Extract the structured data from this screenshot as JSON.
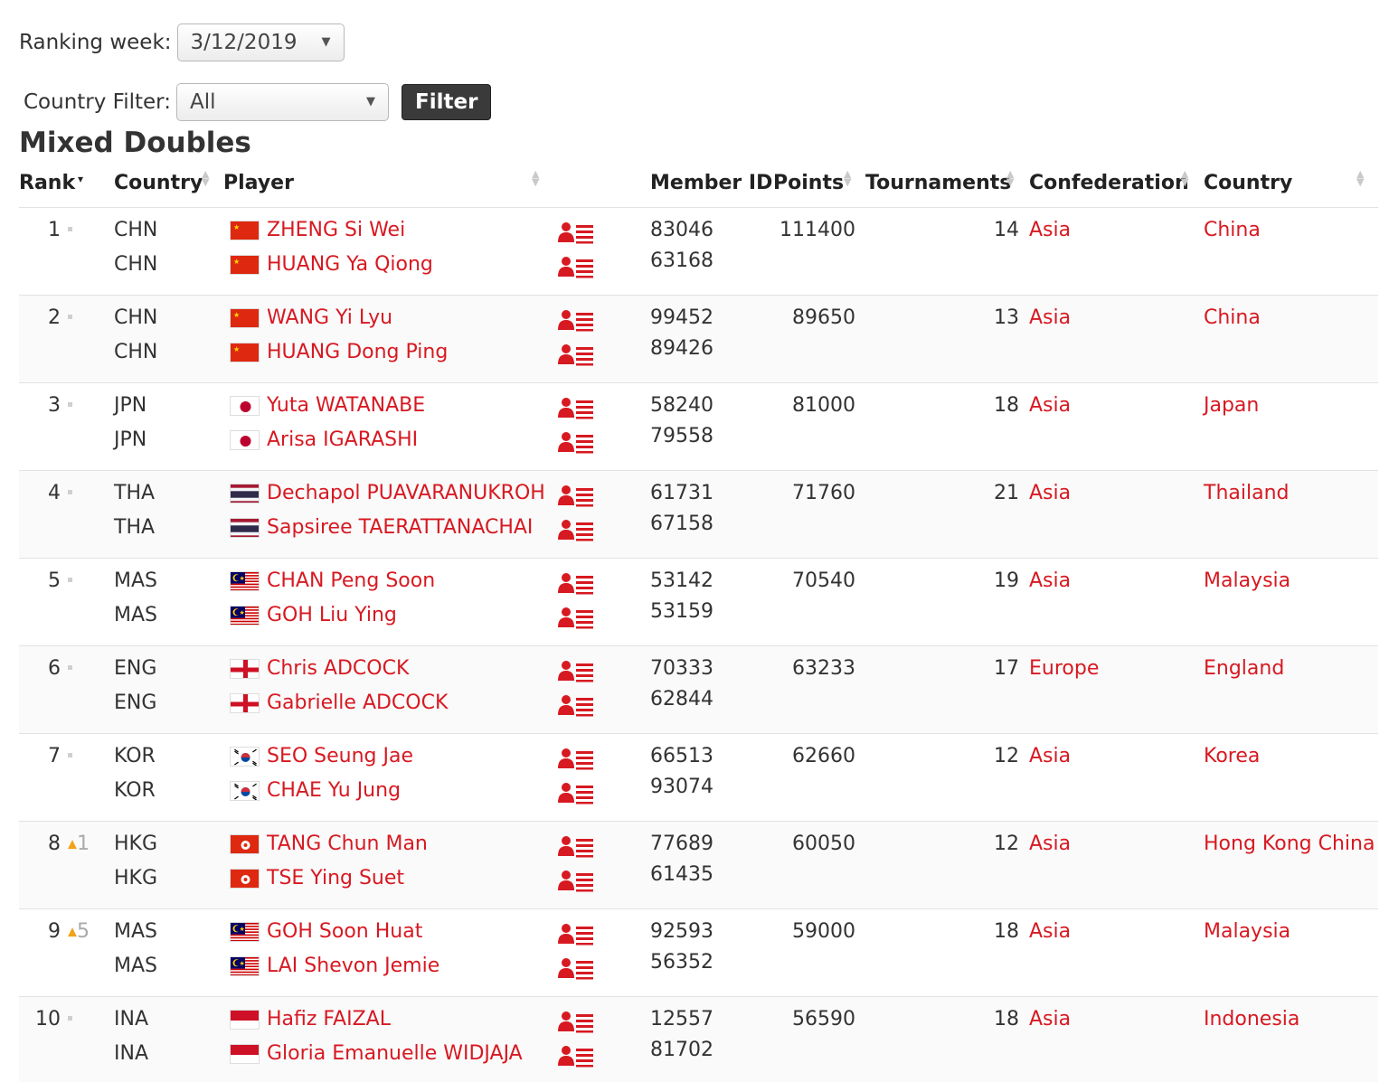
{
  "filters": {
    "week_label": "Ranking week:",
    "week_value": "3/12/2019",
    "country_label": "Country Filter:",
    "country_value": "All",
    "filter_button": "Filter"
  },
  "title": "Mixed Doubles",
  "headers": {
    "rank": "Rank",
    "country": "Country",
    "player": "Player",
    "member_id": "Member ID",
    "points": "Points",
    "tournaments": "Tournaments",
    "confederation": "Confederation",
    "country2": "Country"
  },
  "colors": {
    "link": "#d71921",
    "trend_up": "#f2a31a"
  },
  "rows": [
    {
      "rank": "1",
      "trend": "same",
      "change": "",
      "codes": [
        "CHN",
        "CHN"
      ],
      "flag": "chn",
      "players": [
        "ZHENG Si Wei",
        "HUANG Ya Qiong"
      ],
      "ids": [
        "83046",
        "63168"
      ],
      "points": "111400",
      "tournaments": "14",
      "confederation": "Asia",
      "country": "China"
    },
    {
      "rank": "2",
      "trend": "same",
      "change": "",
      "codes": [
        "CHN",
        "CHN"
      ],
      "flag": "chn",
      "players": [
        "WANG Yi Lyu",
        "HUANG Dong Ping"
      ],
      "ids": [
        "99452",
        "89426"
      ],
      "points": "89650",
      "tournaments": "13",
      "confederation": "Asia",
      "country": "China"
    },
    {
      "rank": "3",
      "trend": "same",
      "change": "",
      "codes": [
        "JPN",
        "JPN"
      ],
      "flag": "jpn",
      "players": [
        "Yuta WATANABE",
        "Arisa IGARASHI"
      ],
      "ids": [
        "58240",
        "79558"
      ],
      "points": "81000",
      "tournaments": "18",
      "confederation": "Asia",
      "country": "Japan"
    },
    {
      "rank": "4",
      "trend": "same",
      "change": "",
      "codes": [
        "THA",
        "THA"
      ],
      "flag": "tha",
      "players": [
        "Dechapol PUAVARANUKROH",
        "Sapsiree TAERATTANACHAI"
      ],
      "ids": [
        "61731",
        "67158"
      ],
      "points": "71760",
      "tournaments": "21",
      "confederation": "Asia",
      "country": "Thailand"
    },
    {
      "rank": "5",
      "trend": "same",
      "change": "",
      "codes": [
        "MAS",
        "MAS"
      ],
      "flag": "mas",
      "players": [
        "CHAN Peng Soon",
        "GOH Liu Ying"
      ],
      "ids": [
        "53142",
        "53159"
      ],
      "points": "70540",
      "tournaments": "19",
      "confederation": "Asia",
      "country": "Malaysia"
    },
    {
      "rank": "6",
      "trend": "same",
      "change": "",
      "codes": [
        "ENG",
        "ENG"
      ],
      "flag": "eng",
      "players": [
        "Chris ADCOCK",
        "Gabrielle ADCOCK"
      ],
      "ids": [
        "70333",
        "62844"
      ],
      "points": "63233",
      "tournaments": "17",
      "confederation": "Europe",
      "country": "England"
    },
    {
      "rank": "7",
      "trend": "same",
      "change": "",
      "codes": [
        "KOR",
        "KOR"
      ],
      "flag": "kor",
      "players": [
        "SEO Seung Jae",
        "CHAE Yu Jung"
      ],
      "ids": [
        "66513",
        "93074"
      ],
      "points": "62660",
      "tournaments": "12",
      "confederation": "Asia",
      "country": "Korea"
    },
    {
      "rank": "8",
      "trend": "up",
      "change": "1",
      "codes": [
        "HKG",
        "HKG"
      ],
      "flag": "hkg",
      "players": [
        "TANG Chun Man",
        "TSE Ying Suet"
      ],
      "ids": [
        "77689",
        "61435"
      ],
      "points": "60050",
      "tournaments": "12",
      "confederation": "Asia",
      "country": "Hong Kong China"
    },
    {
      "rank": "9",
      "trend": "up",
      "change": "5",
      "codes": [
        "MAS",
        "MAS"
      ],
      "flag": "mas",
      "players": [
        "GOH Soon Huat",
        "LAI Shevon Jemie"
      ],
      "ids": [
        "92593",
        "56352"
      ],
      "points": "59000",
      "tournaments": "18",
      "confederation": "Asia",
      "country": "Malaysia"
    },
    {
      "rank": "10",
      "trend": "same",
      "change": "",
      "codes": [
        "INA",
        "INA"
      ],
      "flag": "ina",
      "players": [
        "Hafiz FAIZAL",
        "Gloria Emanuelle WIDJAJA"
      ],
      "ids": [
        "12557",
        "81702"
      ],
      "points": "56590",
      "tournaments": "18",
      "confederation": "Asia",
      "country": "Indonesia"
    }
  ]
}
